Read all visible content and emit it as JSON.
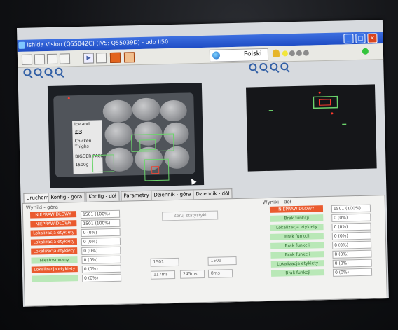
{
  "window": {
    "title": "Ishida Vision (Q55042C) (IVS: Q55039D) - udo II50",
    "minimize": "_",
    "maximize": "□",
    "close": "×"
  },
  "toolbar": {
    "language": "Polski",
    "status_dots": [
      "yellow",
      "gray",
      "gray",
      "gray"
    ],
    "indicator_color": "#34c43c"
  },
  "left_image": {
    "label_lines": [
      "Iceland",
      "£3",
      "Chicken",
      "Thighs",
      "BIGGER PACK",
      "1500g"
    ]
  },
  "tabs": [
    {
      "label": "Uruchom",
      "active": true
    },
    {
      "label": "Konfig - góra"
    },
    {
      "label": "Konfig - dół"
    },
    {
      "label": "Parametry"
    },
    {
      "label": "Dziennik - góra"
    },
    {
      "label": "Dziennik - dół"
    }
  ],
  "results_top": {
    "title": "Wyniki - góra",
    "rows": [
      {
        "label": "NIEPRAWIDŁOWY",
        "value": "1501 (100%)",
        "style": "red"
      },
      {
        "label": "NIEPRAWIDŁOWY",
        "value": "1501 (100%)",
        "style": "red"
      },
      {
        "label": "Lokalizacja etykiety",
        "value": "0 (0%)",
        "style": "red"
      },
      {
        "label": "Lokalizacja etykiety",
        "value": "0 (0%)",
        "style": "red"
      },
      {
        "label": "Lokalizacja etykiety",
        "value": "0 (0%)",
        "style": "red"
      },
      {
        "label": "Niestosowany",
        "value": "0 (0%)",
        "style": "green"
      },
      {
        "label": "Lokalizacja etykiety",
        "value": "0 (0%)",
        "style": "red"
      },
      {
        "label": "",
        "value": "0 (0%)",
        "style": "green"
      }
    ]
  },
  "center": {
    "reset_stats": "Zeruj statystyki",
    "count_left": "1501",
    "count_right": "1501",
    "time1": "117ms",
    "time2": "245ms",
    "time3": "8ms"
  },
  "results_bottom": {
    "title": "Wyniki - dół",
    "rows": [
      {
        "label": "NIEPRAWIDŁOWY",
        "value": "1501 (100%)",
        "style": "red"
      },
      {
        "label": "Brak funkcji",
        "value": "0 (0%)",
        "style": "green"
      },
      {
        "label": "Lokalizacja etykiety",
        "value": "0 (0%)",
        "style": "green"
      },
      {
        "label": "Brak funkcji",
        "value": "0 (0%)",
        "style": "green"
      },
      {
        "label": "Brak funkcji",
        "value": "0 (0%)",
        "style": "green"
      },
      {
        "label": "Brak funkcji",
        "value": "0 (0%)",
        "style": "green"
      },
      {
        "label": "Lokalizacja etykiety",
        "value": "0 (0%)",
        "style": "green"
      },
      {
        "label": "Brak funkcji",
        "value": "0 (0%)",
        "style": "green"
      }
    ]
  }
}
